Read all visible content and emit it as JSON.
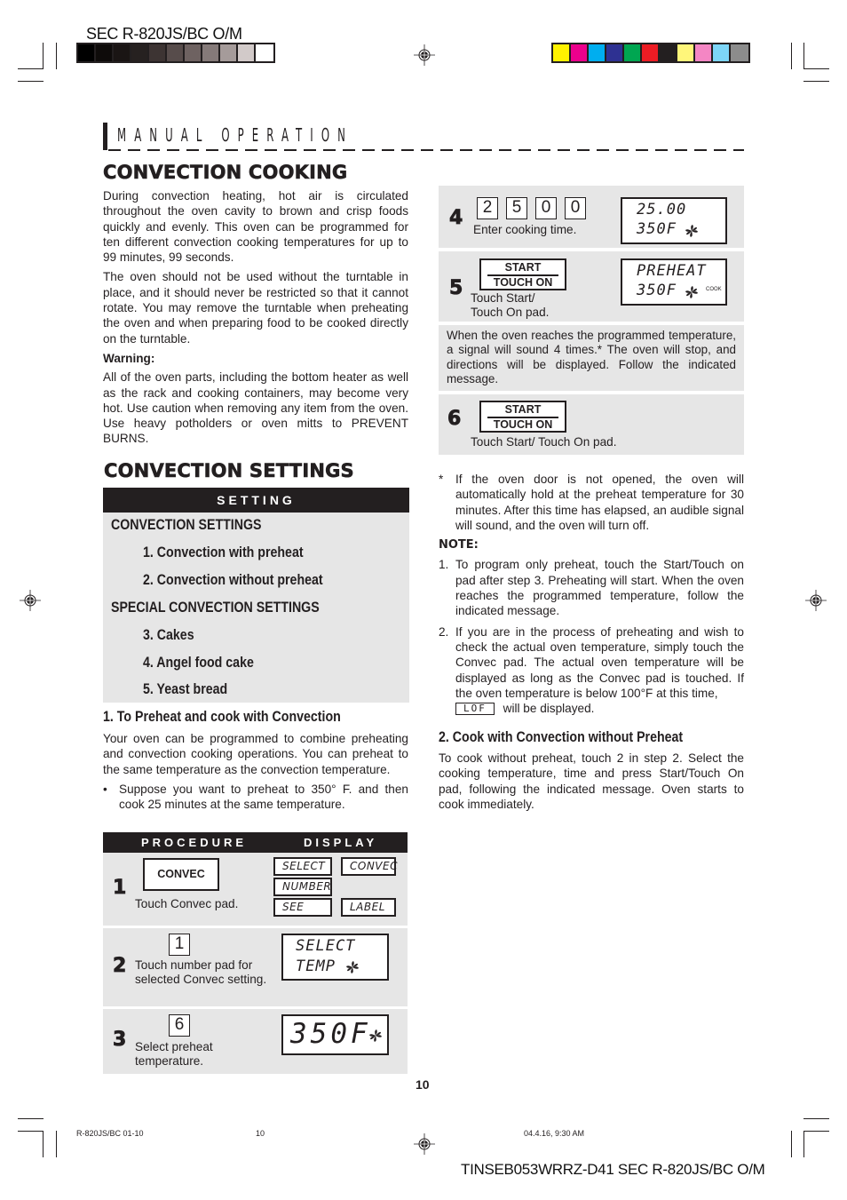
{
  "print_header": {
    "doc_title": "SEC R-820JS/BC O/M",
    "gray_swatches": [
      "#000000",
      "#0e0b0a",
      "#1a1514",
      "#262120",
      "#3d3433",
      "#574c4b",
      "#6e6261",
      "#857a79",
      "#a59b9a",
      "#d2cac9",
      "#ffffff"
    ],
    "color_swatches": [
      "#fff200",
      "#ec008c",
      "#00aeef",
      "#2e3192",
      "#00a651",
      "#ed1c24",
      "#231f20",
      "#fff67a",
      "#f486c4",
      "#7dd5f7",
      "#8c8c8c"
    ]
  },
  "section_header": "MANUAL OPERATION",
  "convection_cooking": {
    "title": "CONVECTION COOKING",
    "paragraphs": [
      "During convection heating, hot air is circulated throughout the oven cavity to brown and crisp foods quickly and evenly. This oven can be programmed for ten different convection cooking temperatures for up to 99 minutes, 99 seconds.",
      "The oven should not be used without the turntable in place, and it should never be restricted so that it cannot rotate. You may remove the turntable when preheating the oven and when preparing food to be cooked directly on the turntable."
    ],
    "warning_label": "Warning:",
    "warning_text": "All of the oven parts, including the bottom heater as well as the rack and cooking containers, may become very hot. Use caution when removing any item from the oven. Use heavy potholders or oven mitts to PREVENT BURNS."
  },
  "convection_settings": {
    "title": "CONVECTION SETTINGS",
    "table_header": "SETTING",
    "rows": [
      "CONVECTION SETTINGS",
      "1. Convection with preheat",
      "2. Convection without preheat",
      "SPECIAL CONVECTION SETTINGS",
      "3. Cakes",
      "4. Angel food cake",
      "5. Yeast bread"
    ]
  },
  "preheat_section": {
    "title": "1. To Preheat and cook with Convection",
    "intro": "Your oven can be programmed to combine preheating and convection cooking operations. You can preheat to the same temperature as the convection temperature.",
    "bullet": "Suppose you want to preheat to 350° F. and then cook 25 minutes at the same temperature.",
    "bullet_marker": "•"
  },
  "procedure": {
    "col_procedure": "PROCEDURE",
    "col_display": "DISPLAY",
    "steps": [
      {
        "num": "1",
        "pad": "CONVEC",
        "label": "Touch Convec pad.",
        "display": [
          "SELECT",
          "CONVEC",
          "NUMBER",
          "SEE",
          "LABEL"
        ]
      },
      {
        "num": "2",
        "digit": "1",
        "label": "Touch number pad for selected Convec setting.",
        "display": [
          "SELECT",
          "TEMP"
        ]
      },
      {
        "num": "3",
        "digit": "6",
        "label": "Select preheat temperature.",
        "display": [
          "350F"
        ]
      },
      {
        "num": "4",
        "digits": [
          "2",
          "5",
          "0",
          "0"
        ],
        "label": "Enter cooking time.",
        "display": [
          "25.00",
          "350F"
        ]
      },
      {
        "num": "5",
        "pad_top": "START",
        "pad_bottom": "TOUCH ON",
        "label_1": "Touch Start/",
        "label_2": "Touch On pad.",
        "display": [
          "PREHEAT",
          "350F"
        ],
        "indicator": "COOK"
      },
      {
        "num": "6",
        "pad_top": "START",
        "pad_bottom": "TOUCH ON",
        "label": "Touch Start/ Touch On pad."
      }
    ],
    "reach_note": "When the oven reaches the programmed temperature, a signal will sound 4 times.* The oven will stop, and directions will be displayed. Follow the indicated message."
  },
  "footnote": {
    "marker": "*",
    "text": "If the oven door is not opened, the oven will automatically hold at the preheat temperature for 30 minutes. After this time has elapsed, an audible signal will sound, and the oven will turn off."
  },
  "note": {
    "label": "NOTE:",
    "items": [
      {
        "marker": "1.",
        "text": "To program only preheat, touch the Start/Touch on pad after step 3. Preheating will start. When the oven reaches the programmed temperature, follow the indicated message."
      },
      {
        "marker": "2.",
        "text": "If you are in the process of preheating and wish to check the actual oven temperature, simply touch the Convec pad. The actual oven temperature will be displayed as long as the Convec pad is touched. If the oven temperature is below 100°F at this time,",
        "lcd": "LOF",
        "text_after": "will be displayed."
      }
    ]
  },
  "without_preheat": {
    "title": "2. Cook with Convection without Preheat",
    "text": "To cook without preheat, touch 2 in step 2. Select the cooking temperature, time and press Start/Touch On pad, following the indicated message. Oven starts to cook immediately."
  },
  "page_number": "10",
  "print_footer": {
    "file_name": "R-820JS/BC 01-10",
    "page": "10",
    "timestamp": "04.4.16, 9:30 AM",
    "doc_code": "TINSEB053WRRZ-D41 SEC R-820JS/BC O/M"
  }
}
